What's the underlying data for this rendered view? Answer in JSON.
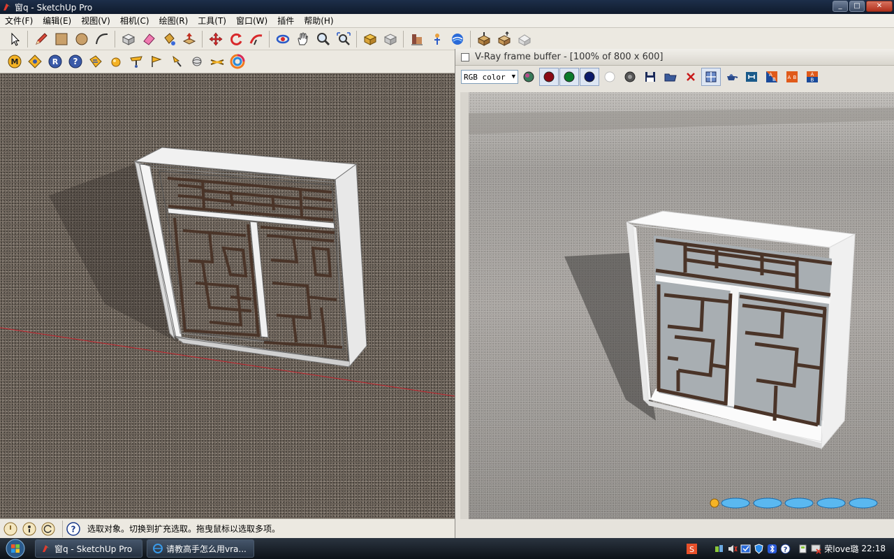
{
  "window": {
    "title": "窗q - SketchUp Pro"
  },
  "menu": {
    "items": [
      "文件(F)",
      "编辑(E)",
      "视图(V)",
      "相机(C)",
      "绘图(R)",
      "工具(T)",
      "窗口(W)",
      "插件",
      "帮助(H)"
    ]
  },
  "toolbar1": {
    "tools": [
      "select-icon",
      "pencil-icon",
      "rectangle-icon",
      "circle-icon",
      "arc-icon",
      "make-component-icon",
      "eraser-icon",
      "paint-bucket-icon",
      "push-pull-icon",
      "move-icon",
      "rotate-icon",
      "follow-me-icon",
      "orbit-icon",
      "pan-icon",
      "zoom-icon",
      "zoom-extents-icon",
      "get-models-icon",
      "share-model-icon",
      "google-earth-icon",
      "get-current-view-icon",
      "toggle-terrain-icon",
      "place-model-icon"
    ]
  },
  "toolbar2": {
    "buttons": [
      {
        "icon": "material-editor-icon",
        "label": "M"
      },
      {
        "icon": "options-icon",
        "label": ""
      },
      {
        "icon": "render-icon",
        "label": "R"
      },
      {
        "icon": "help-icon",
        "label": "?"
      },
      {
        "icon": "frame-buffer-icon",
        "label": ""
      },
      {
        "icon": "sphere-icon",
        "label": ""
      },
      {
        "icon": "omni-light-icon",
        "label": ""
      },
      {
        "icon": "spot-light-icon",
        "label": ""
      },
      {
        "icon": "ies-light-icon",
        "label": ""
      },
      {
        "icon": "dome-light-icon",
        "label": ""
      },
      {
        "icon": "infinite-plane-icon",
        "label": ""
      },
      {
        "icon": "vray-logo-icon",
        "label": ""
      }
    ]
  },
  "statusbar": {
    "text": "选取对象。切换到扩充选取。拖曳鼠标以选取多项。",
    "icons": [
      "geo-location-icon",
      "credits-icon",
      "sign-in-icon",
      "instructor-help-icon"
    ]
  },
  "vfb": {
    "title": "V-Ray frame buffer - [100% of 800 x 600]",
    "channel_select": "RGB color",
    "tools": [
      "color-swatch-icon",
      "red-channel-icon",
      "green-channel-icon",
      "blue-channel-icon",
      "alpha-channel-icon",
      "monochrome-icon",
      "save-icon",
      "open-icon",
      "clear-icon",
      "region-render-icon",
      "render-last-icon",
      "lut-icon",
      "compare-a-icon",
      "compare-ab-icon",
      "compare-b-icon"
    ],
    "pressed": [
      "red-channel-icon",
      "green-channel-icon",
      "blue-channel-icon",
      "region-render-icon"
    ]
  },
  "taskbar": {
    "buttons": [
      {
        "icon": "sketchup-icon",
        "label": "窗q - SketchUp Pro"
      },
      {
        "icon": "ie-icon",
        "label": "请教高手怎么用vra..."
      }
    ],
    "tray_user": "荣love璐",
    "clock": "22:18"
  },
  "colors": {
    "axis_red": "#c8222c",
    "frame_white": "#f2f2f2",
    "lattice_brown": "#4a3428",
    "vray_orange": "#f07a1e"
  }
}
